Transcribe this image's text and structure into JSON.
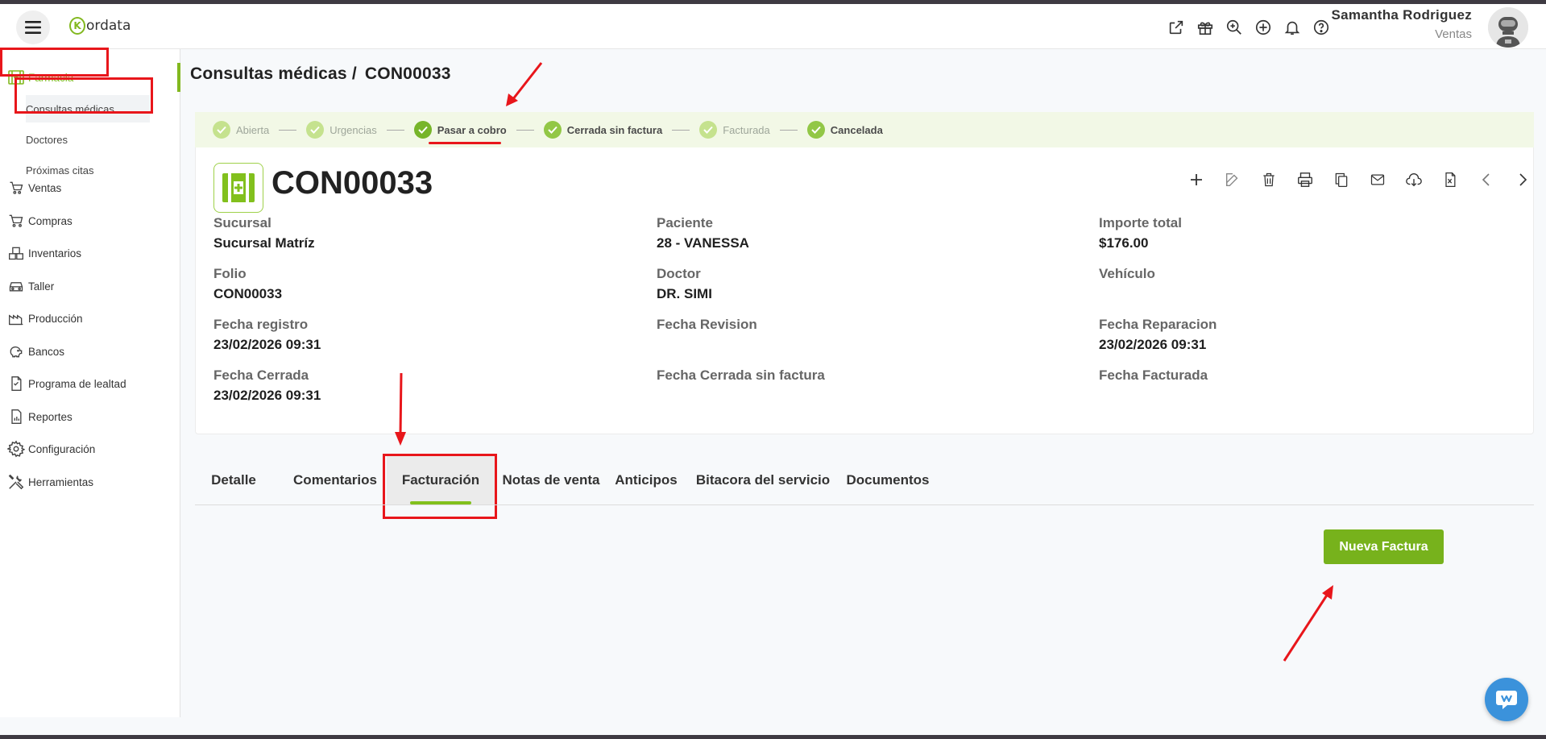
{
  "header": {
    "logo_text": "ordata",
    "logo_letter": "K",
    "user_name": "Samantha Rodriguez",
    "user_role": "Ventas",
    "icons": [
      "external-link-icon",
      "gift-icon",
      "search-zoom-icon",
      "add-circle-icon",
      "bell-icon",
      "help-icon"
    ]
  },
  "sidebar": {
    "items": [
      {
        "label": "Farmacia",
        "icon": "pharmacy-icon"
      },
      {
        "label": "Ventas",
        "icon": "sales-icon"
      },
      {
        "label": "Compras",
        "icon": "cart-icon"
      },
      {
        "label": "Inventarios",
        "icon": "boxes-icon"
      },
      {
        "label": "Taller",
        "icon": "car-icon"
      },
      {
        "label": "Producción",
        "icon": "factory-icon"
      },
      {
        "label": "Bancos",
        "icon": "piggy-bank-icon"
      },
      {
        "label": "Programa de lealtad",
        "icon": "loyalty-icon"
      },
      {
        "label": "Reportes",
        "icon": "report-icon"
      },
      {
        "label": "Configuración",
        "icon": "gear-icon"
      },
      {
        "label": "Herramientas",
        "icon": "tools-icon"
      }
    ],
    "subitems": [
      {
        "label": "Consultas médicas"
      },
      {
        "label": "Doctores"
      },
      {
        "label": "Próximas citas"
      }
    ]
  },
  "page": {
    "section": "Consultas médicas /",
    "record": "CON00033"
  },
  "stepper": {
    "steps": [
      {
        "label": "Abierta"
      },
      {
        "label": "Urgencias"
      },
      {
        "label": "Pasar a cobro"
      },
      {
        "label": "Cerrada sin factura"
      },
      {
        "label": "Facturada"
      },
      {
        "label": "Cancelada"
      }
    ]
  },
  "record": {
    "number": "CON00033",
    "fields": {
      "sucursal": {
        "label": "Sucursal",
        "value": "Sucursal Matríz"
      },
      "paciente": {
        "label": "Paciente",
        "value": "28 - VANESSA"
      },
      "importe": {
        "label": "Importe total",
        "value": "$176.00"
      },
      "folio": {
        "label": "Folio",
        "value": "CON00033"
      },
      "doctor": {
        "label": "Doctor",
        "value": "DR. SIMI"
      },
      "vehiculo": {
        "label": "Vehículo",
        "value": ""
      },
      "fecha_registro": {
        "label": "Fecha registro",
        "value": "23/02/2026 09:31"
      },
      "fecha_revision": {
        "label": "Fecha Revision",
        "value": ""
      },
      "fecha_reparacion": {
        "label": "Fecha Reparacion",
        "value": "23/02/2026 09:31"
      },
      "fecha_cerrada": {
        "label": "Fecha Cerrada",
        "value": "23/02/2026 09:31"
      },
      "fecha_cerrada_sin_factura": {
        "label": "Fecha Cerrada sin factura",
        "value": ""
      },
      "fecha_facturada": {
        "label": "Fecha Facturada",
        "value": ""
      }
    }
  },
  "toolbar": {
    "icons": [
      "add-icon",
      "edit-icon",
      "delete-icon",
      "print-icon",
      "copy-icon",
      "email-icon",
      "download-icon",
      "excel-icon",
      "chevron-left-icon",
      "chevron-right-icon"
    ]
  },
  "tabs": [
    {
      "label": "Detalle"
    },
    {
      "label": "Comentarios"
    },
    {
      "label": "Facturación"
    },
    {
      "label": "Notas de venta"
    },
    {
      "label": "Anticipos"
    },
    {
      "label": "Bitacora del servicio"
    },
    {
      "label": "Documentos"
    }
  ],
  "actions": {
    "nueva_factura": "Nueva Factura"
  },
  "colors": {
    "accent": "#82b81f",
    "button": "#77b21c",
    "annotation": "#e8161b",
    "chat": "#3b92db"
  }
}
